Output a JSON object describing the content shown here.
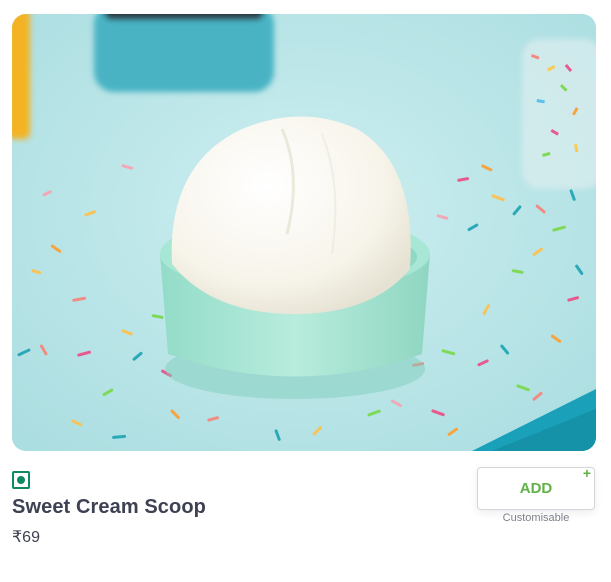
{
  "item": {
    "image_alt": "Sweet Cream Scoop",
    "veg_indicator": "veg-icon",
    "name": "Sweet Cream Scoop",
    "price": "₹69"
  },
  "actions": {
    "add_label": "ADD",
    "add_plus": "+",
    "customisable_label": "Customisable"
  },
  "colors": {
    "veg_green": "#0f8a65",
    "add_green": "#60b246",
    "text_dark": "#3e4152",
    "text_muted": "#7e808c",
    "image_background": "#b9e6e8"
  }
}
